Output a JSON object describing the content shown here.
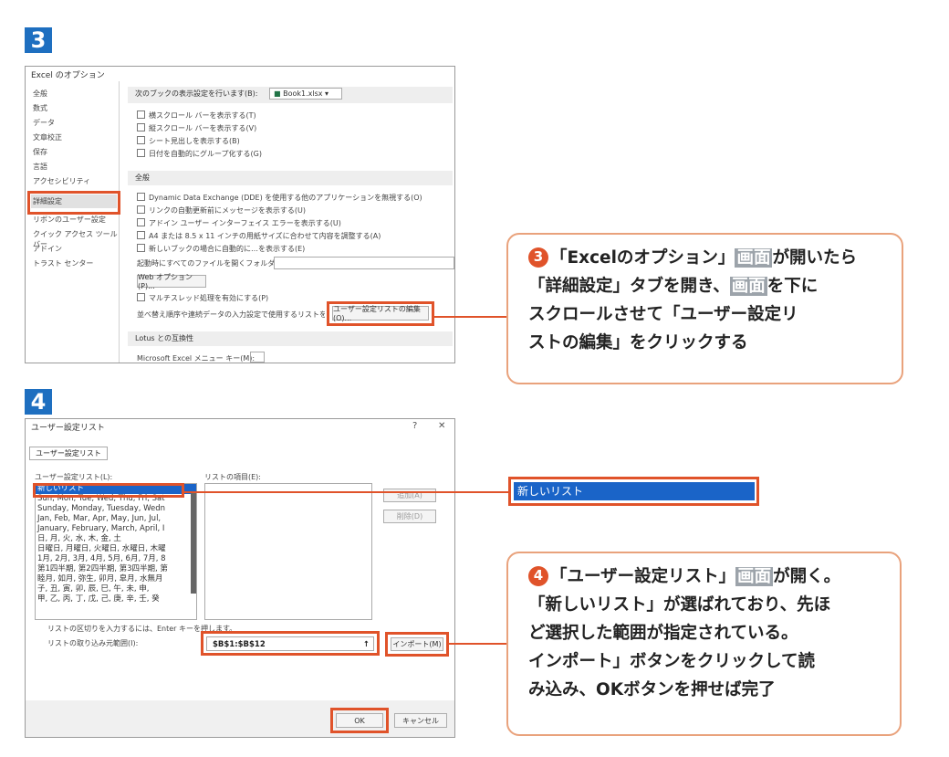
{
  "step3": {
    "badge": "3",
    "window_title": "Excel のオプション",
    "nav": [
      "全般",
      "数式",
      "データ",
      "文章校正",
      "保存",
      "言語",
      "アクセシビリティ",
      "詳細設定",
      "リボンのユーザー設定",
      "クイック アクセス ツール バー",
      "アドイン",
      "トラスト センター"
    ],
    "top_option_label": "次のブックの表示設定を行います(B):",
    "top_option_value": "Book1.xlsx",
    "top_options": [
      "横スクロール バーを表示する(T)",
      "縦スクロール バーを表示する(V)",
      "シート見出しを表示する(B)",
      "日付を自動的にグループ化する(G)"
    ],
    "section_general": "全般",
    "general_options": [
      "Dynamic Data Exchange (DDE) を使用する他のアプリケーションを無視する(O)",
      "リンクの自動更新前にメッセージを表示する(U)",
      "アドイン ユーザー インターフェイス エラーを表示する(U)",
      "A4 または 8.5 x 11 インチの用紙サイズに合わせて内容を調整する(A)",
      "新しいブックの場合に自動的に…を表示する(E)"
    ],
    "startup_label": "起動時にすべてのファイルを開くフォルダー(L):",
    "web_button": "Web オプション(P)...",
    "multithread_option": "マルチスレッド処理を有効にする(P)",
    "sort_label": "並べ替え順序や連続データの入力設定で使用するリストを作成します:",
    "edit_list_button": "ユーザー設定リストの編集(O)...",
    "section_lotus": "Lotus との互換性",
    "lotus_label": "Microsoft Excel メニュー キー(M):"
  },
  "callout3": {
    "num": "3",
    "line1_pre": "「Excelのオプション」",
    "line1_mark": "画面",
    "line1_post": "が開いたら",
    "line2_pre": "「詳細設定」タブを開き、",
    "line2_mark": "画面",
    "line2_post": "を下に",
    "line3": "スクロールさせて「ユーザー設定リ",
    "line4": "ストの編集」をクリックする"
  },
  "step4": {
    "badge": "4",
    "window_title": "ユーザー設定リスト",
    "help": "?",
    "close": "✕",
    "tab": "ユーザー設定リスト",
    "list_label": "ユーザー設定リスト(L):",
    "entries_label": "リストの項目(E):",
    "list_items": [
      "新しいリスト",
      "Sun, Mon, Tue, Wed, Thu, Fri, Sat",
      "Sunday, Monday, Tuesday, Wedn",
      "Jan, Feb, Mar, Apr, May, Jun, Jul,",
      "January, February, March, April, I",
      "日, 月, 火, 水, 木, 金, 土",
      "日曜日, 月曜日, 火曜日, 水曜日, 木曜",
      "1月, 2月, 3月, 4月, 5月, 6月, 7月, 8",
      "第1四半期, 第2四半期, 第3四半期, 第",
      "睦月, 如月, 弥生, 卯月, 皐月, 水無月",
      "子, 丑, 寅, 卯, 辰, 巳, 午, 未, 申,",
      "甲, 乙, 丙, 丁, 戊, 己, 庚, 辛, 壬, 癸"
    ],
    "add_button": "追加(A)",
    "delete_button": "削除(D)",
    "hint": "リストの区切りを入力するには、Enter キーを押します。",
    "import_label": "リストの取り込み元範囲(I):",
    "range_value": "$B$1:$B$12",
    "import_button": "インポート(M)",
    "ok_button": "OK",
    "cancel_button": "キャンセル"
  },
  "new_list_zoom": "新しいリスト",
  "callout4": {
    "num": "4",
    "line1_pre": "「ユーザー設定リスト」",
    "line1_mark": "画面",
    "line1_post": "が開く。",
    "line2": "「新しいリスト」が選ばれており、先ほ",
    "line3": "ど選択した範囲が指定されている。",
    "line4": "インポート」ボタンをクリックして読",
    "line5": "み込み、OKボタンを押せば完了"
  }
}
